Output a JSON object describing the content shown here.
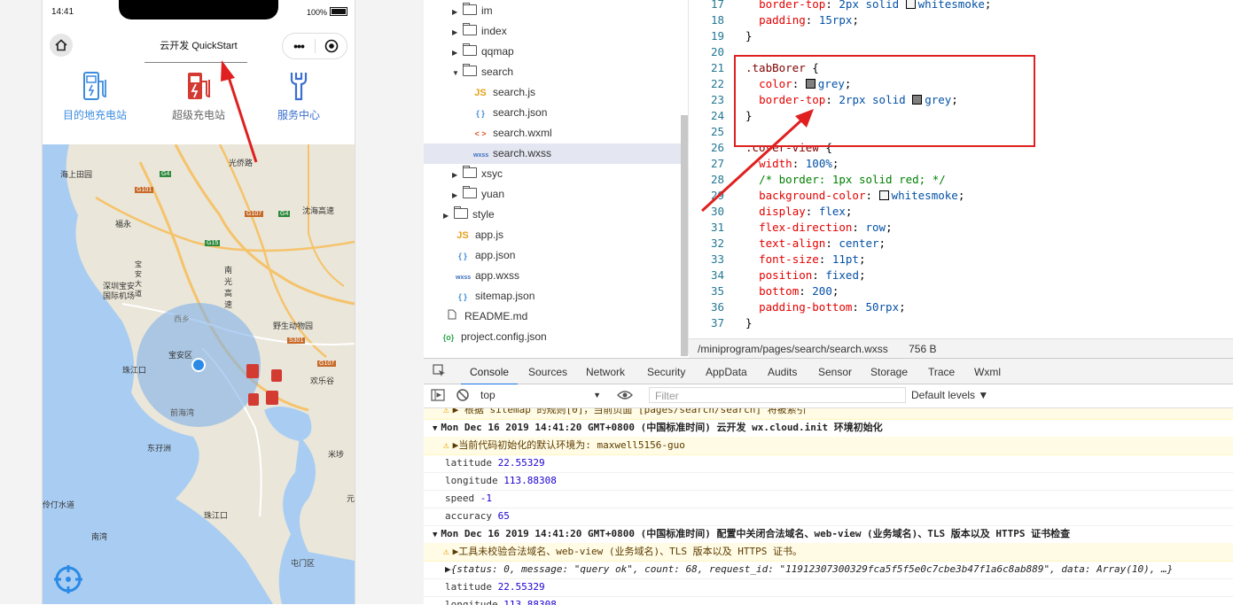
{
  "phone": {
    "time": "14:41",
    "battery": "100%",
    "title": "云开发 QuickStart",
    "capsule_more": "•••",
    "tabs": [
      {
        "label": "目的地充电站",
        "color": "#3b8cdf"
      },
      {
        "label": "超级充电站",
        "color": "#d33a31"
      },
      {
        "label": "服务中心",
        "color": "#3b6fd0"
      }
    ],
    "map_labels": [
      "光侨路",
      "海上田园",
      "福永",
      "沈海高速",
      "南光高速",
      "深圳宝安国际机场",
      "西乡",
      "野生动物园",
      "宝安区",
      "珠江口",
      "前海湾",
      "欢乐谷",
      "东孖洲",
      "米埗",
      "伶仃水道",
      "珠江口",
      "南湾",
      "屯门区",
      "元",
      "宝安大道",
      "G4",
      "G15",
      "S301",
      "G107",
      "G101",
      "G107",
      "G4"
    ]
  },
  "tree": {
    "items": [
      {
        "label": "im",
        "type": "folder",
        "open": false
      },
      {
        "label": "index",
        "type": "folder",
        "open": false
      },
      {
        "label": "qqmap",
        "type": "folder",
        "open": false
      },
      {
        "label": "search",
        "type": "folder",
        "open": true
      },
      {
        "label": "search.js",
        "type": "js",
        "icon": "JS"
      },
      {
        "label": "search.json",
        "type": "json",
        "icon": "{ }"
      },
      {
        "label": "search.wxml",
        "type": "wxml",
        "icon": "< >"
      },
      {
        "label": "search.wxss",
        "type": "wxss",
        "icon": "wxss"
      },
      {
        "label": "xsyc",
        "type": "folder",
        "open": false
      },
      {
        "label": "yuan",
        "type": "folder",
        "open": false
      },
      {
        "label": "style",
        "type": "folder",
        "open": false
      },
      {
        "label": "app.js",
        "type": "js",
        "icon": "JS"
      },
      {
        "label": "app.json",
        "type": "json",
        "icon": "{ }"
      },
      {
        "label": "app.wxss",
        "type": "wxss",
        "icon": "wxss"
      },
      {
        "label": "sitemap.json",
        "type": "json",
        "icon": "{ }"
      },
      {
        "label": "README.md",
        "type": "file"
      },
      {
        "label": "project.config.json",
        "type": "cfg",
        "icon": "{o}"
      }
    ]
  },
  "editor": {
    "lines": [
      {
        "n": "17",
        "indent": "  ",
        "parts": [
          [
            "prop",
            "border-top"
          ],
          [
            "pun",
            ": "
          ],
          [
            "val",
            "2px solid "
          ],
          [
            "swatch",
            "#f5f5f5"
          ],
          [
            "val",
            "whitesmoke"
          ],
          [
            "pun",
            ";"
          ]
        ]
      },
      {
        "n": "18",
        "indent": "  ",
        "parts": [
          [
            "prop",
            "padding"
          ],
          [
            "pun",
            ": "
          ],
          [
            "val",
            "15rpx"
          ],
          [
            "pun",
            ";"
          ]
        ]
      },
      {
        "n": "19",
        "indent": "",
        "parts": [
          [
            "pun",
            "}"
          ]
        ]
      },
      {
        "n": "20",
        "indent": "",
        "parts": []
      },
      {
        "n": "21",
        "indent": "",
        "parts": [
          [
            "sel",
            ".tabBorer "
          ],
          [
            "pun",
            "{"
          ]
        ]
      },
      {
        "n": "22",
        "indent": "  ",
        "parts": [
          [
            "prop",
            "color"
          ],
          [
            "pun",
            ": "
          ],
          [
            "swatch",
            "#808080"
          ],
          [
            "val",
            "grey"
          ],
          [
            "pun",
            ";"
          ]
        ]
      },
      {
        "n": "23",
        "indent": "  ",
        "parts": [
          [
            "prop",
            "border-top"
          ],
          [
            "pun",
            ": "
          ],
          [
            "val",
            "2rpx solid "
          ],
          [
            "swatch",
            "#808080"
          ],
          [
            "val",
            "grey"
          ],
          [
            "pun",
            ";"
          ]
        ]
      },
      {
        "n": "24",
        "indent": "",
        "parts": [
          [
            "pun",
            "}"
          ]
        ]
      },
      {
        "n": "25",
        "indent": "",
        "parts": []
      },
      {
        "n": "26",
        "indent": "",
        "parts": [
          [
            "sel",
            ".cover-view "
          ],
          [
            "pun",
            "{"
          ]
        ]
      },
      {
        "n": "27",
        "indent": "  ",
        "parts": [
          [
            "prop",
            "width"
          ],
          [
            "pun",
            ": "
          ],
          [
            "val",
            "100%"
          ],
          [
            "pun",
            ";"
          ]
        ]
      },
      {
        "n": "28",
        "indent": "  ",
        "parts": [
          [
            "com",
            "/* border: 1px solid red; */"
          ]
        ]
      },
      {
        "n": "29",
        "indent": "  ",
        "parts": [
          [
            "prop",
            "background-color"
          ],
          [
            "pun",
            ": "
          ],
          [
            "swatch",
            "#f5f5f5"
          ],
          [
            "val",
            "whitesmoke"
          ],
          [
            "pun",
            ";"
          ]
        ]
      },
      {
        "n": "30",
        "indent": "  ",
        "parts": [
          [
            "prop",
            "display"
          ],
          [
            "pun",
            ": "
          ],
          [
            "val",
            "flex"
          ],
          [
            "pun",
            ";"
          ]
        ]
      },
      {
        "n": "31",
        "indent": "  ",
        "parts": [
          [
            "prop",
            "flex-direction"
          ],
          [
            "pun",
            ": "
          ],
          [
            "val",
            "row"
          ],
          [
            "pun",
            ";"
          ]
        ]
      },
      {
        "n": "32",
        "indent": "  ",
        "parts": [
          [
            "prop",
            "text-align"
          ],
          [
            "pun",
            ": "
          ],
          [
            "val",
            "center"
          ],
          [
            "pun",
            ";"
          ]
        ]
      },
      {
        "n": "33",
        "indent": "  ",
        "parts": [
          [
            "prop",
            "font-size"
          ],
          [
            "pun",
            ": "
          ],
          [
            "val",
            "11pt"
          ],
          [
            "pun",
            ";"
          ]
        ]
      },
      {
        "n": "34",
        "indent": "  ",
        "parts": [
          [
            "prop",
            "position"
          ],
          [
            "pun",
            ": "
          ],
          [
            "val",
            "fixed"
          ],
          [
            "pun",
            ";"
          ]
        ]
      },
      {
        "n": "35",
        "indent": "  ",
        "parts": [
          [
            "prop",
            "bottom"
          ],
          [
            "pun",
            ": "
          ],
          [
            "val",
            "200"
          ],
          [
            "pun",
            ";"
          ]
        ]
      },
      {
        "n": "36",
        "indent": "  ",
        "parts": [
          [
            "prop",
            "padding-bottom"
          ],
          [
            "pun",
            ": "
          ],
          [
            "val",
            "50rpx"
          ],
          [
            "pun",
            ";"
          ]
        ]
      },
      {
        "n": "37",
        "indent": "",
        "parts": [
          [
            "pun",
            "}"
          ]
        ]
      }
    ],
    "status_path": "/miniprogram/pages/search/search.wxss",
    "status_size": "756 B"
  },
  "devtools": {
    "tabs": [
      "Console",
      "Sources",
      "Network",
      "Security",
      "AppData",
      "Audits",
      "Sensor",
      "Storage",
      "Trace",
      "Wxml"
    ],
    "active_tab": "Console",
    "context": "top",
    "filter_placeholder": "Filter",
    "levels": "Default levels ▼",
    "rows": [
      {
        "kind": "warn-cut",
        "text": "▶ 根据 sitemap 的规则[0]，当前页面 [pages/search/search] 将被索引"
      },
      {
        "kind": "group",
        "text": "Mon Dec 16 2019 14:41:20 GMT+0800 (中国标准时间) 云开发 wx.cloud.init 环境初始化"
      },
      {
        "kind": "warn",
        "text": "▶当前代码初始化的默认环境为: maxwell5156-guo"
      },
      {
        "kind": "kv",
        "key": "latitude",
        "value": "22.55329"
      },
      {
        "kind": "kv",
        "key": "longitude",
        "value": "113.88308"
      },
      {
        "kind": "kv",
        "key": "speed",
        "value": "-1"
      },
      {
        "kind": "kv",
        "key": "accuracy",
        "value": "65"
      },
      {
        "kind": "group",
        "text": "Mon Dec 16 2019 14:41:20 GMT+0800 (中国标准时间) 配置中关闭合法域名、web-view (业务域名)、TLS 版本以及 HTTPS 证书检查"
      },
      {
        "kind": "warn",
        "text": "▶工具未校验合法域名、web-view (业务域名)、TLS 版本以及 HTTPS 证书。"
      },
      {
        "kind": "obj",
        "text": "▶{status: 0, message: \"query ok\", count: 68, request_id: \"11912307300329fca5f5f5e0c7cbe3b47f1a6c8ab889\", data: Array(10), …}"
      },
      {
        "kind": "kv",
        "key": "latitude",
        "value": "22.55329"
      },
      {
        "kind": "kv",
        "key": "longitude",
        "value": "113.88308"
      }
    ]
  },
  "colors": {
    "accent": "#1a73e8",
    "highlight_box": "#e02020",
    "arrow": "#e02020"
  }
}
